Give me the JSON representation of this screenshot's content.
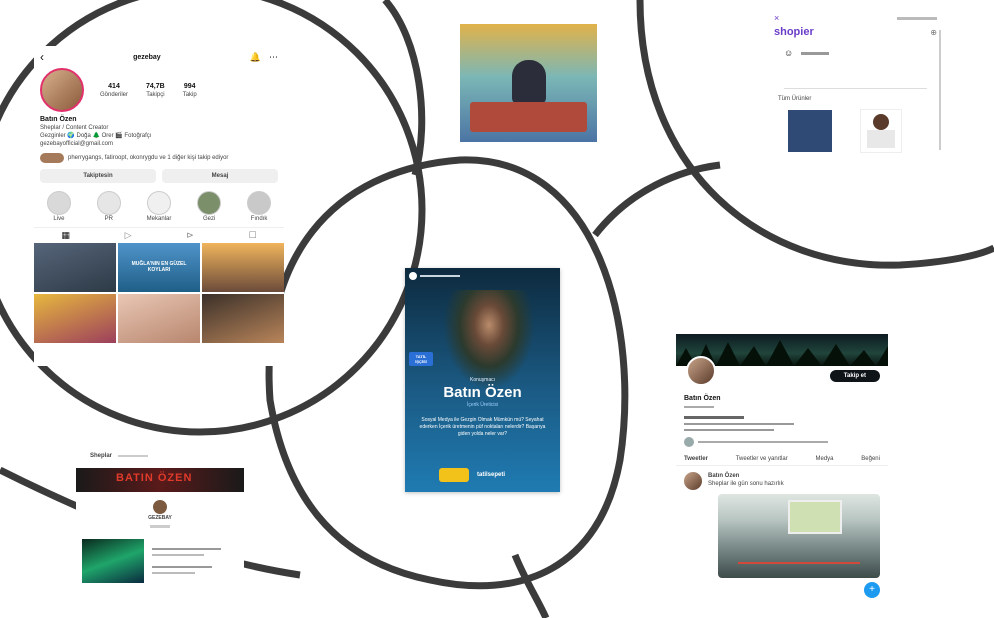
{
  "instagram": {
    "username": "gezebay",
    "stats": [
      {
        "value": "414",
        "label": "Gönderiler"
      },
      {
        "value": "74,7B",
        "label": "Takipçi"
      },
      {
        "value": "994",
        "label": "Takip"
      }
    ],
    "name": "Batın Özen",
    "bio_lines": [
      "Sheplar / Content Creator",
      "Gezginler 🌍 Doğa 🌲 Orer 🎬 Fotoğrafçı",
      "gezebayofficial@gmail.com"
    ],
    "followed_note": "pherrygangs, fatiroopt, okonrygdu ve 1 diğer kişi takip ediyor",
    "follow_button": "Takiptesin",
    "message_button": "Mesaj",
    "highlights": [
      "Live",
      "PR",
      "Mekanlar",
      "Gezi",
      "Fındık"
    ],
    "grid_caption": "MUĞLA'NIN EN GÜZEL KOYLARI"
  },
  "poster": {
    "badge": "TATİL İŞÇİSİ",
    "host_label": "Konuşmacı",
    "guest_name": "Batın Özen",
    "guest_role": "İçerik Üreticisi",
    "questions": "Sosyal Medya ile Gezgin Olmak Mümkün mü? Seyahat ederken İçerik üretmenin püf noktaları nelerdir? Başarıya giden yolda neler var?",
    "brand": "tatilsepeti"
  },
  "shopier": {
    "brand": "shopier",
    "section_label": "Tüm Ürünler"
  },
  "twitter": {
    "name": "Batın Özen",
    "follow_button": "Takip et",
    "tabs": [
      "Tweetler",
      "Tweetler ve yanıtlar",
      "Medya",
      "Beğeni"
    ],
    "tweet_author": "Batın Özen",
    "tweet_text": "Sheplar ile gün sonu hazırlık"
  },
  "youtube": {
    "header": "Sheplar",
    "banner_text": "BATIN ÖZEN",
    "channel": "GEZEBAY"
  }
}
